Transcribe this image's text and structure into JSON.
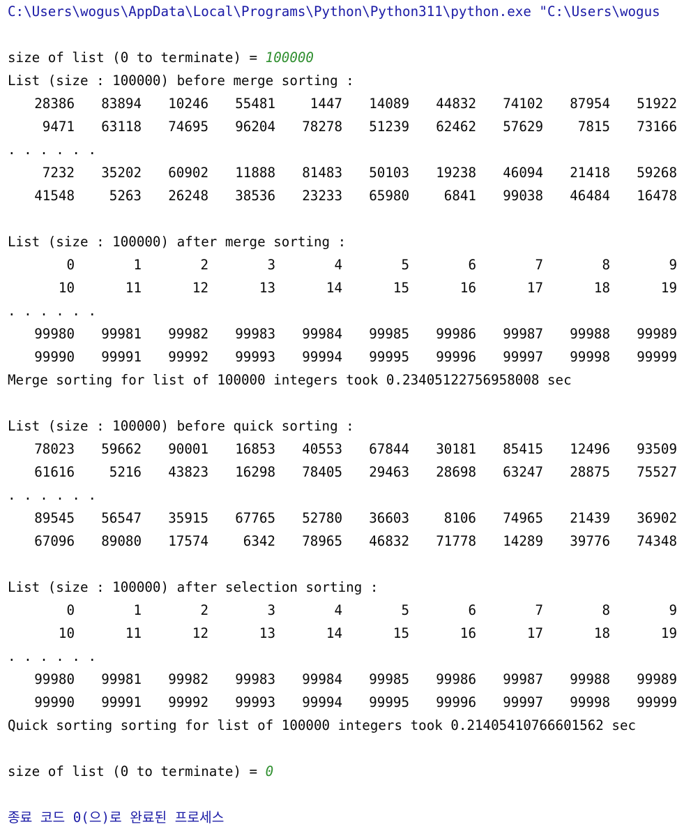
{
  "command_line": "C:\\Users\\wogus\\AppData\\Local\\Programs\\Python\\Python311\\python.exe \"C:\\Users\\wogus",
  "ellipsis": ". . . . . .",
  "prompt_label": "size of list (0 to terminate) = ",
  "first_input": "100000",
  "merge": {
    "before_header": "List (size : 100000) before merge sorting :",
    "before_first": [
      [
        "28386",
        "83894",
        "10246",
        "55481",
        "1447",
        "14089",
        "44832",
        "74102",
        "87954",
        "51922"
      ],
      [
        "9471",
        "63118",
        "74695",
        "96204",
        "78278",
        "51239",
        "62462",
        "57629",
        "7815",
        "73166"
      ]
    ],
    "before_last": [
      [
        "7232",
        "35202",
        "60902",
        "11888",
        "81483",
        "50103",
        "19238",
        "46094",
        "21418",
        "59268"
      ],
      [
        "41548",
        "5263",
        "26248",
        "38536",
        "23233",
        "65980",
        "6841",
        "99038",
        "46484",
        "16478"
      ]
    ],
    "after_header": "List (size : 100000) after merge sorting :",
    "after_first": [
      [
        "0",
        "1",
        "2",
        "3",
        "4",
        "5",
        "6",
        "7",
        "8",
        "9"
      ],
      [
        "10",
        "11",
        "12",
        "13",
        "14",
        "15",
        "16",
        "17",
        "18",
        "19"
      ]
    ],
    "after_last": [
      [
        "99980",
        "99981",
        "99982",
        "99983",
        "99984",
        "99985",
        "99986",
        "99987",
        "99988",
        "99989"
      ],
      [
        "99990",
        "99991",
        "99992",
        "99993",
        "99994",
        "99995",
        "99996",
        "99997",
        "99998",
        "99999"
      ]
    ],
    "timing": "Merge sorting for list of 100000 integers took 0.23405122756958008 sec"
  },
  "quick": {
    "before_header": "List (size : 100000) before quick sorting :",
    "before_first": [
      [
        "78023",
        "59662",
        "90001",
        "16853",
        "40553",
        "67844",
        "30181",
        "85415",
        "12496",
        "93509"
      ],
      [
        "61616",
        "5216",
        "43823",
        "16298",
        "78405",
        "29463",
        "28698",
        "63247",
        "28875",
        "75527"
      ]
    ],
    "before_last": [
      [
        "89545",
        "56547",
        "35915",
        "67765",
        "52780",
        "36603",
        "8106",
        "74965",
        "21439",
        "36902"
      ],
      [
        "67096",
        "89080",
        "17574",
        "6342",
        "78965",
        "46832",
        "71778",
        "14289",
        "39776",
        "74348"
      ]
    ],
    "after_header": "List (size : 100000) after selection sorting :",
    "after_first": [
      [
        "0",
        "1",
        "2",
        "3",
        "4",
        "5",
        "6",
        "7",
        "8",
        "9"
      ],
      [
        "10",
        "11",
        "12",
        "13",
        "14",
        "15",
        "16",
        "17",
        "18",
        "19"
      ]
    ],
    "after_last": [
      [
        "99980",
        "99981",
        "99982",
        "99983",
        "99984",
        "99985",
        "99986",
        "99987",
        "99988",
        "99989"
      ],
      [
        "99990",
        "99991",
        "99992",
        "99993",
        "99994",
        "99995",
        "99996",
        "99997",
        "99998",
        "99999"
      ]
    ],
    "timing": "Quick sorting sorting for list of 100000 integers took 0.21405410766601562 sec"
  },
  "second_input": "0",
  "exit_message": "종료 코드 0(으)로 완료된 프로세스",
  "colors": {
    "command": "#1a1aa6",
    "input": "#2f8f2f",
    "text": "#080808",
    "background": "#ffffff"
  }
}
